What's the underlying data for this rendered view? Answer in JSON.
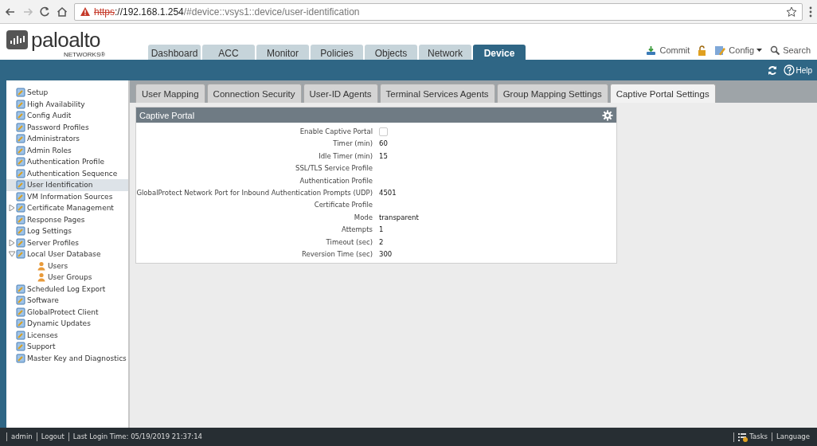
{
  "browser": {
    "url_scheme": "https",
    "url_host": "://192.168.1.254",
    "url_path": "/#device::vsys1::device/user-identification"
  },
  "header": {
    "logo_word": "paloalto",
    "logo_sub": "NETWORKS®",
    "tabs": [
      {
        "label": "Dashboard",
        "selected": false
      },
      {
        "label": "ACC",
        "selected": false
      },
      {
        "label": "Monitor",
        "selected": false
      },
      {
        "label": "Policies",
        "selected": false
      },
      {
        "label": "Objects",
        "selected": false
      },
      {
        "label": "Network",
        "selected": false
      },
      {
        "label": "Device",
        "selected": true
      }
    ],
    "actions": {
      "commit": "Commit",
      "config": "Config",
      "search": "Search"
    },
    "help": "Help"
  },
  "sidebar": {
    "items": [
      {
        "label": "Setup",
        "selected": false
      },
      {
        "label": "High Availability",
        "selected": false
      },
      {
        "label": "Config Audit",
        "selected": false
      },
      {
        "label": "Password Profiles",
        "selected": false
      },
      {
        "label": "Administrators",
        "selected": false
      },
      {
        "label": "Admin Roles",
        "selected": false
      },
      {
        "label": "Authentication Profile",
        "selected": false
      },
      {
        "label": "Authentication Sequence",
        "selected": false
      },
      {
        "label": "User Identification",
        "selected": true
      },
      {
        "label": "VM Information Sources",
        "selected": false
      },
      {
        "label": "Certificate Management",
        "selected": false,
        "expanded": false
      },
      {
        "label": "Response Pages",
        "selected": false
      },
      {
        "label": "Log Settings",
        "selected": false
      },
      {
        "label": "Server Profiles",
        "selected": false,
        "expanded": false
      },
      {
        "label": "Local User Database",
        "selected": false,
        "expanded": true,
        "children": [
          {
            "label": "Users",
            "selected": false
          },
          {
            "label": "User Groups",
            "selected": false
          }
        ]
      },
      {
        "label": "Scheduled Log Export",
        "selected": false
      },
      {
        "label": "Software",
        "selected": false
      },
      {
        "label": "GlobalProtect Client",
        "selected": false
      },
      {
        "label": "Dynamic Updates",
        "selected": false
      },
      {
        "label": "Licenses",
        "selected": false
      },
      {
        "label": "Support",
        "selected": false
      },
      {
        "label": "Master Key and Diagnostics",
        "selected": false
      }
    ]
  },
  "subtabs": [
    {
      "label": "User Mapping",
      "selected": false
    },
    {
      "label": "Connection Security",
      "selected": false
    },
    {
      "label": "User-ID Agents",
      "selected": false
    },
    {
      "label": "Terminal Services Agents",
      "selected": false
    },
    {
      "label": "Group Mapping Settings",
      "selected": false
    },
    {
      "label": "Captive Portal Settings",
      "selected": true
    }
  ],
  "panel": {
    "title": "Captive Portal",
    "fields": [
      {
        "label": "Enable Captive Portal",
        "kind": "checkbox",
        "checked": false
      },
      {
        "label": "Timer (min)",
        "kind": "text",
        "value": "60"
      },
      {
        "label": "Idle Timer (min)",
        "kind": "text",
        "value": "15"
      },
      {
        "label": "SSL/TLS Service Profile",
        "kind": "text"
      },
      {
        "label": "Authentication Profile",
        "kind": "text"
      },
      {
        "label": "GlobalProtect Network Port for Inbound Authentication Prompts (UDP)",
        "kind": "text",
        "value": "4501"
      },
      {
        "label": "Certificate Profile",
        "kind": "text"
      },
      {
        "label": "Mode",
        "kind": "text",
        "value": "transparent"
      },
      {
        "label": "Attempts",
        "kind": "text",
        "value": "1"
      },
      {
        "label": "Timeout (sec)",
        "kind": "text",
        "value": "2"
      },
      {
        "label": "Reversion Time (sec)",
        "kind": "text",
        "value": "300"
      }
    ]
  },
  "status_bar": {
    "user": "admin",
    "logout": "Logout",
    "last_login": "Last Login Time: 05/19/2019 21:37:14",
    "tasks": "Tasks",
    "language": "Language"
  }
}
